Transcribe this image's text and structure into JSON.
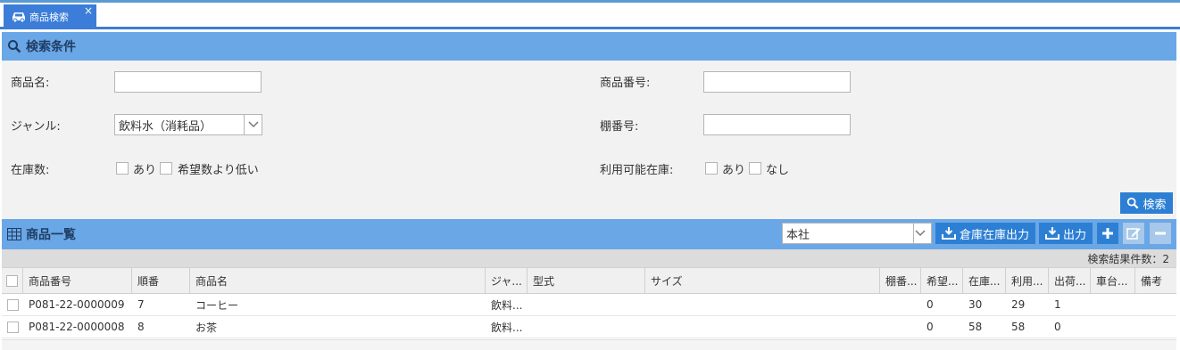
{
  "tab": {
    "label": "商品検索",
    "close": "×"
  },
  "search_panel": {
    "title": "検索条件",
    "product_name_label": "商品名:",
    "product_name_value": "",
    "product_number_label": "商品番号:",
    "product_number_value": "",
    "genre_label": "ジャンル:",
    "genre_value": "飲料水（消耗品）",
    "shelf_number_label": "棚番号:",
    "shelf_number_value": "",
    "stock_label": "在庫数:",
    "stock_opt_yes": "あり",
    "stock_opt_low": "希望数より低い",
    "avail_label": "利用可能在庫:",
    "avail_opt_yes": "あり",
    "avail_opt_no": "なし",
    "search_button": "検索"
  },
  "list_panel": {
    "title": "商品一覧",
    "warehouse_value": "本社",
    "warehouse_stock_button": "倉庫在庫出力",
    "export_button": "出力",
    "add_icon": "plus-icon",
    "edit_icon": "edit-icon",
    "remove_icon": "minus-icon",
    "result_count": "検索結果件数：2"
  },
  "table": {
    "headers": [
      "商品番号",
      "順番",
      "商品名",
      "ジャ...",
      "型式",
      "サイズ",
      "棚番...",
      "希望...",
      "在庫...",
      "利用...",
      "出荷...",
      "車台...",
      "備考"
    ],
    "rows": [
      [
        "P081-22-0000009",
        "7",
        "コーヒー",
        "飲料...",
        "",
        "",
        "",
        "0",
        "30",
        "29",
        "1",
        "",
        ""
      ],
      [
        "P081-22-0000008",
        "8",
        "お茶",
        "飲料...",
        "",
        "",
        "",
        "0",
        "58",
        "58",
        "0",
        "",
        ""
      ]
    ]
  },
  "colors": {
    "accent": "#3b7dd8",
    "panel_header": "#6aa7e6",
    "button": "#2d7fd3"
  }
}
